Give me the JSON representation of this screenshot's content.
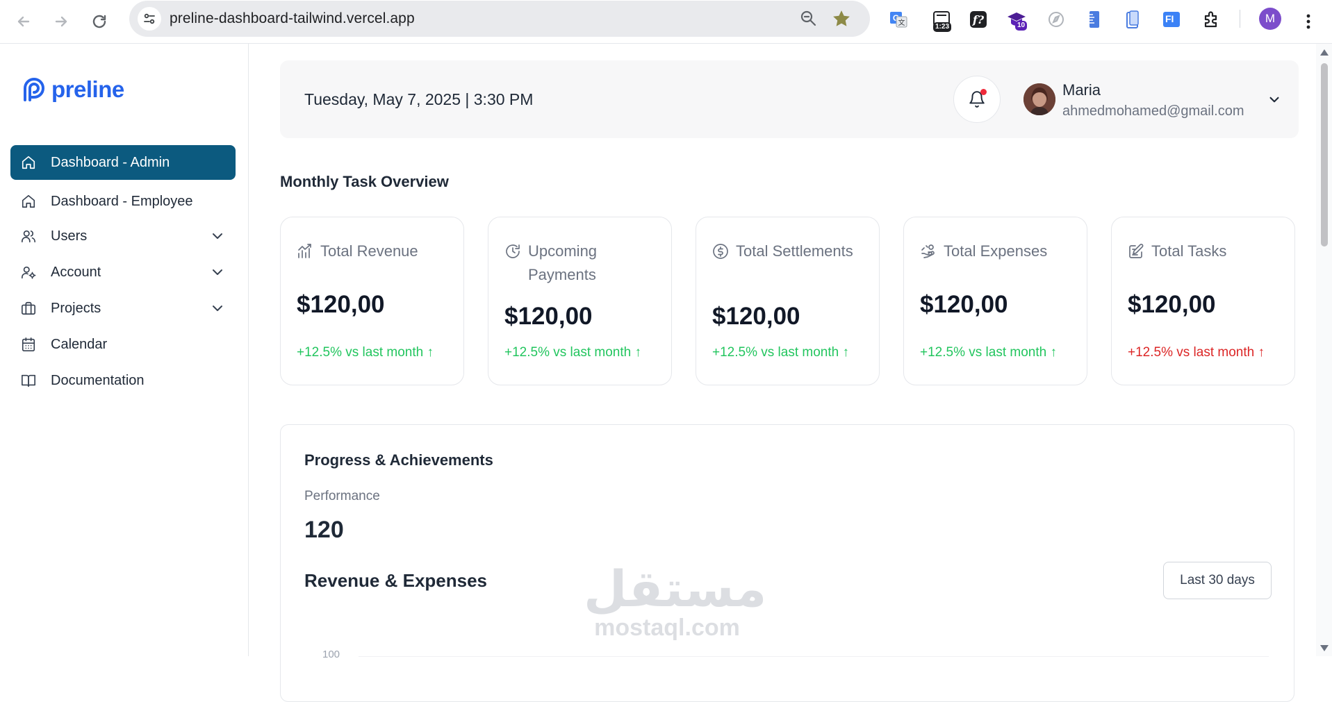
{
  "browser": {
    "url": "preline-dashboard-tailwind.vercel.app",
    "extensions": [
      {
        "name": "google-translate-icon"
      },
      {
        "name": "timer-extension-icon",
        "badge": "1:23"
      },
      {
        "name": "formula-extension-icon"
      },
      {
        "name": "graduation-cap-extension-icon",
        "badge": "10"
      },
      {
        "name": "compass-extension-icon"
      },
      {
        "name": "ruler-extension-icon"
      },
      {
        "name": "phone-extension-icon"
      },
      {
        "name": "fi-extension-icon",
        "label": "FI"
      },
      {
        "name": "puzzle-extensions-icon"
      }
    ],
    "profile_initial": "M"
  },
  "sidebar": {
    "logo_text": "preline",
    "items": [
      {
        "label": "Dashboard - Admin",
        "icon": "home-icon",
        "active": true
      },
      {
        "label": "Dashboard - Employee",
        "icon": "home-icon"
      },
      {
        "label": "Users",
        "icon": "users-icon",
        "expandable": true
      },
      {
        "label": "Account",
        "icon": "user-cog-icon",
        "expandable": true
      },
      {
        "label": "Projects",
        "icon": "briefcase-icon",
        "expandable": true
      },
      {
        "label": "Calendar",
        "icon": "calendar-icon"
      },
      {
        "label": "Documentation",
        "icon": "book-icon"
      }
    ]
  },
  "header": {
    "datetime": "Tuesday, May 7, 2025 | 3:30 PM",
    "user_name": "Maria",
    "user_email": "ahmedmohamed@gmail.com"
  },
  "overview": {
    "title": "Monthly Task Overview",
    "cards": [
      {
        "title": "Total Revenue",
        "icon": "chart-up-icon",
        "value": "$120,00",
        "change": "+12.5% vs last month ↑",
        "trend_color": "#22c55e"
      },
      {
        "title": "Upcoming Payments",
        "icon": "clock-refresh-icon",
        "value": "$120,00",
        "change": "+12.5% vs last month ↑",
        "trend_color": "#22c55e"
      },
      {
        "title": "Total Settlements",
        "icon": "dollar-circle-icon",
        "value": "$120,00",
        "change": "+12.5% vs last month ↑",
        "trend_color": "#22c55e"
      },
      {
        "title": "Total Expenses",
        "icon": "hand-coins-icon",
        "value": "$120,00",
        "change": "+12.5% vs last month ↑",
        "trend_color": "#22c55e"
      },
      {
        "title": "Total Tasks",
        "icon": "edit-square-icon",
        "value": "$120,00",
        "change": "+12.5% vs last month ↑",
        "trend_color": "#dc2626"
      }
    ]
  },
  "progress": {
    "title": "Progress & Achievements",
    "performance_label": "Performance",
    "performance_value": "120",
    "chart_title": "Revenue & Expenses",
    "range_button": "Last 30 days",
    "y_tick_top": "100"
  },
  "watermark": {
    "arabic": "مستقل",
    "latin": "mostaql.com"
  },
  "colors": {
    "brand": "#2563eb",
    "active_nav": "#0c5a7f",
    "positive": "#22c55e",
    "negative": "#dc2626"
  }
}
